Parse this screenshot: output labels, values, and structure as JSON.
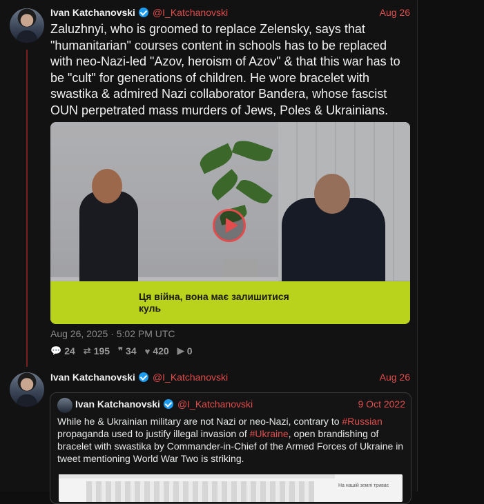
{
  "tweet1": {
    "name": "Ivan Katchanovski",
    "handle": "@I_Katchanovski",
    "date": "Aug 26",
    "text": "Zaluzhnyi, who is groomed to replace Zelensky, says that \"humanitarian\" courses content in schools has to be replaced with neo-Nazi-led \"Azov, heroism of Azov\" & that this war has to be \"cult\" for generations of children. He wore bracelet with swastika & admired Nazi collaborator Bandera, whose fascist OUN perpetrated mass murders of Jews, Poles & Ukrainians.",
    "video_caption_line1": "Ця війна, вона має залишитися",
    "video_caption_line2": "куль",
    "timestamp": "Aug 26, 2025 · 5:02 PM UTC",
    "stats": {
      "replies": "24",
      "retweets": "195",
      "quotes": "34",
      "likes": "420",
      "views": "0"
    }
  },
  "tweet2": {
    "name": "Ivan Katchanovski",
    "handle": "@I_Katchanovski",
    "date": "Aug 26",
    "quote": {
      "name": "Ivan Katchanovski",
      "handle": "@I_Katchanovski",
      "date": "9 Oct 2022",
      "text_part1": "While he & Ukrainian military are not Nazi or neo-Nazi, contrary to ",
      "tag1": "#Russian",
      "text_part2": " propaganda used to justify illegal invasion of ",
      "tag2": "#Ukraine",
      "text_part3": ", open brandishing of bracelet with swastika by Commander-in-Chief of the Armed Forces of Ukraine in tweet mentioning World War Two is striking.",
      "image_side_text": "На нашій землі триває"
    }
  },
  "icons": {
    "replies": "comment-icon",
    "retweets": "retweet-icon",
    "quotes": "quote-icon",
    "likes": "heart-icon",
    "views": "play-icon"
  },
  "colors": {
    "accent": "#e24c4c",
    "verified": "#1d9bf0",
    "caption_bg": "#b9d21c"
  }
}
